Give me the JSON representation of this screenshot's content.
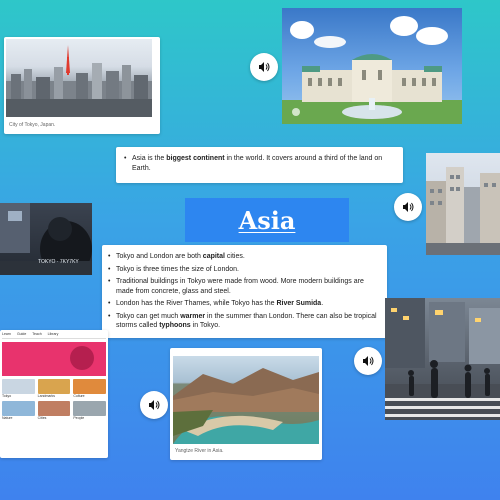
{
  "top_left_photo": {
    "caption": "City of Tokyo, Japan."
  },
  "continent_fact": {
    "prefix": "Asia is the ",
    "bold": "biggest continent",
    "suffix": " in the world. It covers around a third of the land on Earth."
  },
  "title": "Asia",
  "street_photo": {
    "sign_text": "TOKYO · 7KY7KY"
  },
  "comparisons": [
    {
      "before": "Tokyo and London are both ",
      "bold": "capital",
      "after": " cities."
    },
    {
      "before": "Tokyo is three times the size of London.",
      "bold": "",
      "after": ""
    },
    {
      "before": "Traditional buildings in Tokyo were made from wood. More modern buildings are made from concrete, glass and steel.",
      "bold": "",
      "after": ""
    },
    {
      "before": "London has the River Thames, while Tokyo has the ",
      "bold": "River Sumida",
      "after": "."
    },
    {
      "before": "Tokyo can get much ",
      "bold": "warmer",
      "after": " in the summer than London. There can also be tropical storms called ",
      "bold2": "typhoons",
      "after2": " in Tokyo."
    }
  ],
  "river_photo": {
    "caption": "Yangtze River in Asia."
  },
  "website_thumb": {
    "nav": [
      "Learn",
      "Guide",
      "Teach",
      "Library"
    ],
    "row1": [
      "Tokyo",
      "Landmarks",
      "Culture"
    ],
    "row2": [
      "Nature",
      "Cities",
      "People"
    ]
  },
  "icons": {
    "audio": "speaker-icon"
  },
  "colors": {
    "bg_top": "#2ec7c9",
    "bg_bottom": "#3f82ee",
    "title_bg": "#2d86f0"
  }
}
